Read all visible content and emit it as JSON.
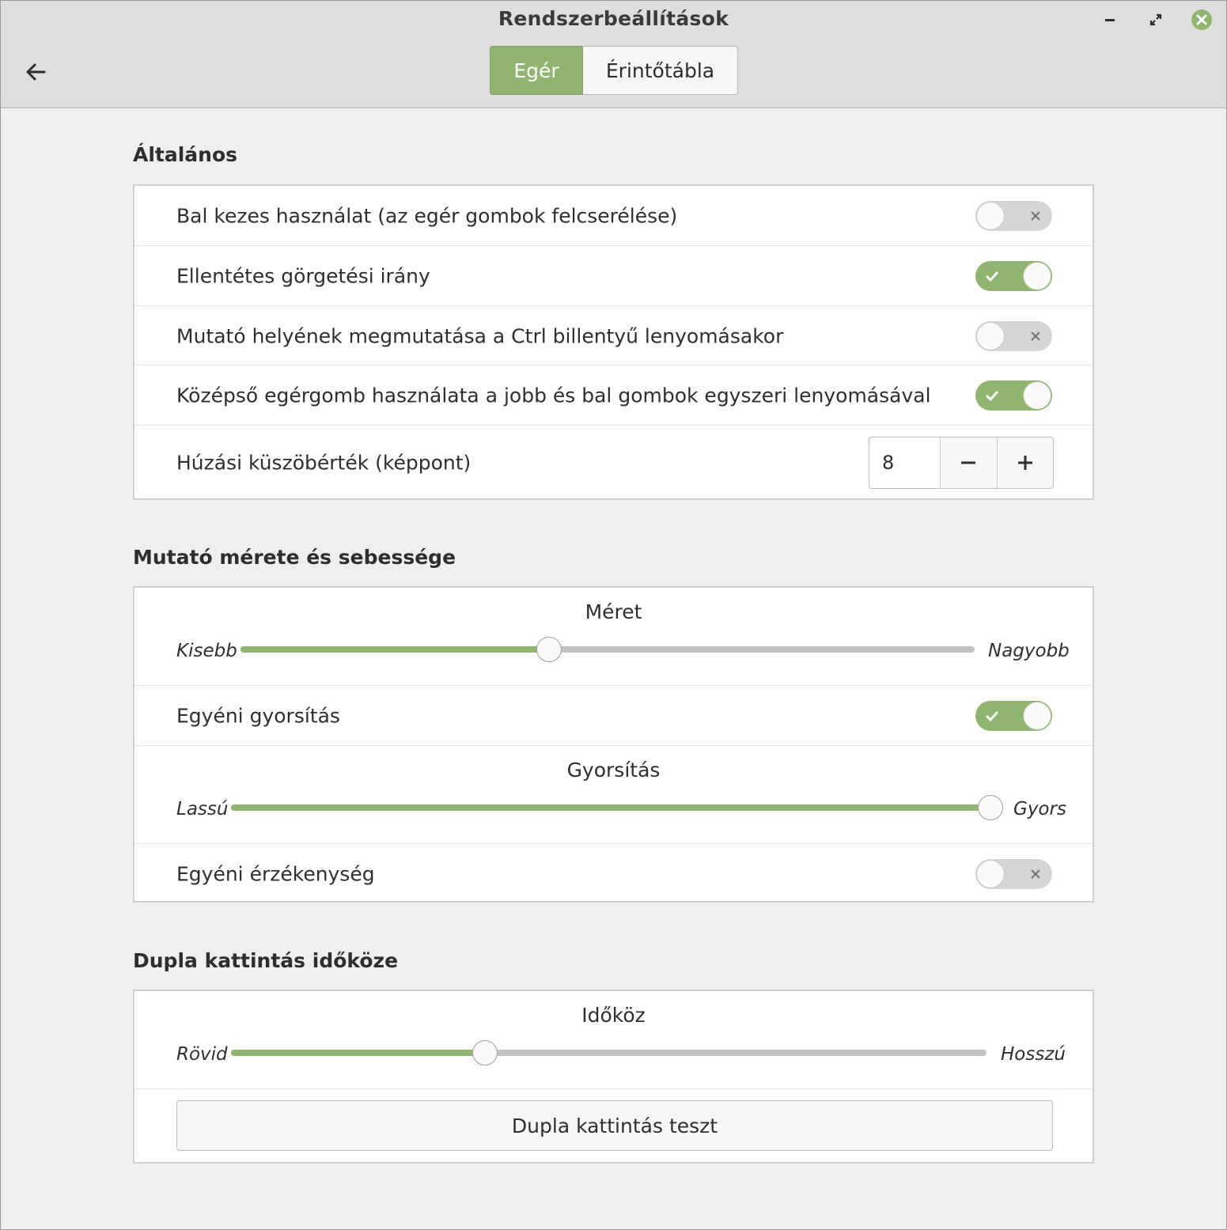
{
  "window": {
    "title": "Rendszerbeállítások"
  },
  "header": {
    "back_icon": "arrow-left-icon",
    "tabs": [
      {
        "label": "Egér",
        "active": true
      },
      {
        "label": "Érintőtábla",
        "active": false
      }
    ]
  },
  "colors": {
    "accent": "#8fb570",
    "switch_off": "#d6d6d6",
    "track": "#c2c2c2",
    "close_button": "#8fb570"
  },
  "general": {
    "title": "Általános",
    "rows": [
      {
        "label": "Bal kezes használat (az egér gombok felcserélése)",
        "state": "off"
      },
      {
        "label": "Ellentétes görgetési irány",
        "state": "on"
      },
      {
        "label": "Mutató helyének megmutatása a Ctrl billentyű lenyomásakor",
        "state": "off"
      },
      {
        "label": "Középső egérgomb használata a jobb és bal gombok egyszeri lenyomásával",
        "state": "on"
      }
    ],
    "drag_threshold": {
      "label": "Húzási küszöbérték (képpont)",
      "value": "8"
    }
  },
  "pointer": {
    "title": "Mutató mérete és sebessége",
    "size": {
      "title": "Méret",
      "min_label": "Kisebb",
      "max_label": "Nagyobb",
      "value": 0.42
    },
    "custom_accel": {
      "label": "Egyéni gyorsítás",
      "state": "on"
    },
    "accel": {
      "title": "Gyorsítás",
      "min_label": "Lassú",
      "max_label": "Gyors",
      "value": 1.0
    },
    "custom_sens": {
      "label": "Egyéni érzékenység",
      "state": "off"
    }
  },
  "double_click": {
    "title": "Dupla kattintás időköze",
    "interval": {
      "title": "Időköz",
      "min_label": "Rövid",
      "max_label": "Hosszú",
      "value": 0.336
    },
    "test_button": "Dupla kattintás teszt"
  }
}
